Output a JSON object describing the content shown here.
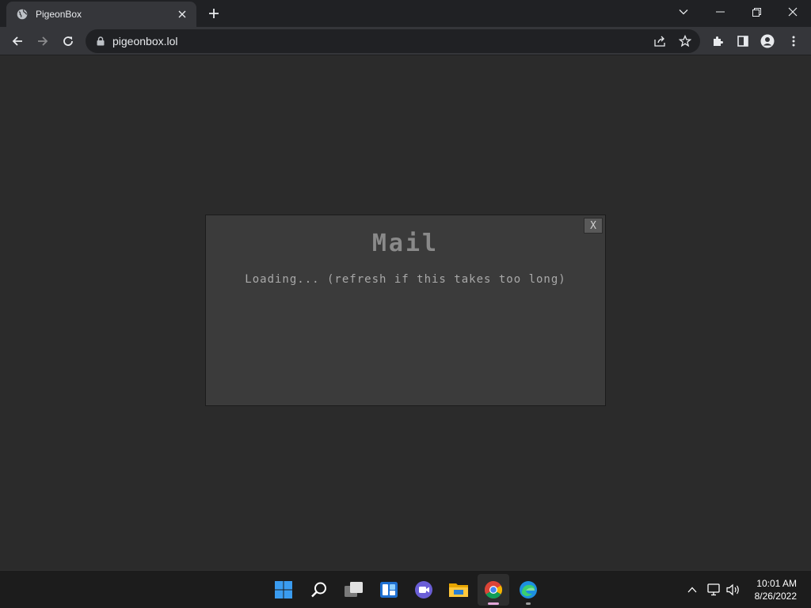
{
  "browser": {
    "tab_title": "PigeonBox",
    "url": "pigeonbox.lol"
  },
  "modal": {
    "close_label": "X",
    "title": "Mail",
    "status": "Loading... (refresh if this takes too long)"
  },
  "taskbar": {
    "time": "10:01 AM",
    "date": "8/26/2022"
  },
  "colors": {
    "titlebar": "#202124",
    "toolbar": "#35363a",
    "page_bg": "#2b2b2b",
    "modal_bg": "#3b3b3b",
    "taskbar": "#1c1c1c",
    "windows_blue": "#3a9cf0"
  },
  "icons": [
    "globe-icon",
    "close-icon",
    "plus-icon",
    "chevron-down-icon",
    "minimize-icon",
    "restore-icon",
    "back-icon",
    "forward-icon",
    "reload-icon",
    "lock-icon",
    "share-icon",
    "star-icon",
    "extensions-icon",
    "side-panel-icon",
    "profile-icon",
    "menu-icon",
    "windows-start-icon",
    "search-icon",
    "task-view-icon",
    "widgets-icon",
    "teams-icon",
    "file-explorer-icon",
    "chrome-icon",
    "edge-icon",
    "chevron-up-icon",
    "network-icon",
    "volume-icon"
  ]
}
